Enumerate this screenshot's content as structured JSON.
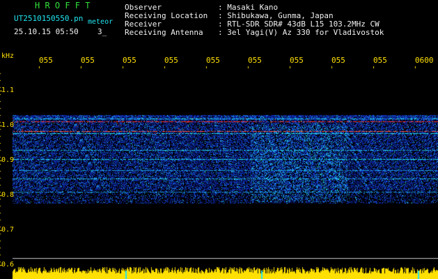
{
  "header": {
    "app_title": "H R O F F T",
    "file_name": "UT2510150550.pn",
    "mode": "meteor",
    "date_time": "25.10.15 05:50",
    "index": "3_"
  },
  "station_info": [
    {
      "label": "Observer",
      "value": ": Masaki Kano"
    },
    {
      "label": "Receiving Location",
      "value": ": Shibukawa, Gunma, Japan"
    },
    {
      "label": "Receiver",
      "value": ": RTL-SDR SDR# 43dB L15 103.2MHz CW"
    },
    {
      "label": "Receiving Antenna",
      "value": ": 3el Yagi(V) Az 330 for Vladivostok"
    }
  ],
  "axis": {
    "unit": "kHz",
    "freq_ticks": [
      "1.1",
      "1.0",
      "0.9",
      "0.8",
      "0.7",
      "0.6"
    ],
    "time_ticks": [
      "055",
      "055",
      "055",
      "055",
      "055",
      "055",
      "055",
      "055",
      "055",
      "0600"
    ]
  },
  "colors": {
    "background": "#000000",
    "noise_blue": "#0a2aa0",
    "signal_cyan": "#20e6f0",
    "echo_red": "#ff3020",
    "level_bar": "#ffe000"
  }
}
